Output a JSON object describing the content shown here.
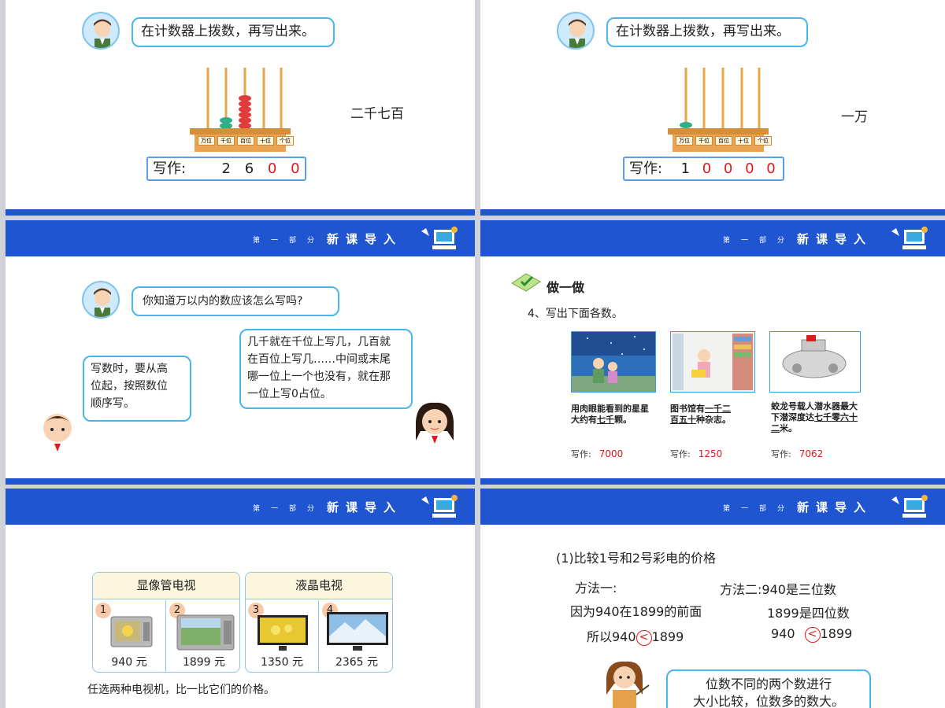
{
  "slide1": {
    "bubble": "在计数器上拨数，再写出来。",
    "word": "二千七百",
    "write_label": "写作:",
    "digits": [
      "2",
      "6",
      "0",
      "0"
    ],
    "places": [
      "万位",
      "千位",
      "百位",
      "十位",
      "个位"
    ]
  },
  "slide2": {
    "bubble": "在计数器上拨数，再写出来。",
    "word": "一万",
    "write_label": "写作:",
    "digits": [
      "1",
      "0",
      "0",
      "0",
      "0"
    ],
    "places": [
      "万位",
      "千位",
      "百位",
      "十位",
      "个位"
    ]
  },
  "header": {
    "part": "第一部分",
    "title": "新课导入"
  },
  "slide3": {
    "question": "你知道万以内的数应该怎么写吗?",
    "boy_text": [
      "写数时，要从高",
      "位起，按照数位",
      "顺序写。"
    ],
    "girl_text": [
      "几千就在千位上写几，几百就",
      "在百位上写几……中间或末尾",
      "哪一位上一个也没有，就在那",
      "一位上写0占位。"
    ]
  },
  "slide4": {
    "section": "做一做",
    "instruction": "4、写出下面各数。",
    "items": [
      {
        "pre": "用肉眼能看到的星星大约有",
        "u": "七千",
        "post": "颗。",
        "write_label": "写作:",
        "value": "7000"
      },
      {
        "pre": "图书馆有",
        "u": "一千二百五十",
        "post": "种杂志。",
        "write_label": "写作:",
        "value": "1250"
      },
      {
        "pre": "蛟龙号载人潜水器最大下潜深度达",
        "u": "七千零六十二",
        "post": "米。",
        "write_label": "写作:",
        "value": "7062"
      }
    ]
  },
  "slide5": {
    "groups": [
      "显像管电视",
      "液晶电视"
    ],
    "tvs": [
      {
        "num": "1",
        "price": "940 元"
      },
      {
        "num": "2",
        "price": "1899 元"
      },
      {
        "num": "3",
        "price": "1350 元"
      },
      {
        "num": "4",
        "price": "2365 元"
      }
    ],
    "prompt": "任选两种电视机，比一比它们的价格。"
  },
  "slide6": {
    "title": "(1)比较1号和2号彩电的价格",
    "m1_label": "方法一:",
    "m1_line1": "因为940在1899的前面",
    "m1_line2a": "所以940",
    "m1_sign": "<",
    "m1_line2b": "1899",
    "m2_line1": "方法二:940是三位数",
    "m2_line2": "1899是四位数",
    "m2_line3a": "940",
    "m2_sign": "<",
    "m2_line3b": "1899",
    "teacher_text": [
      "位数不同的两个数进行",
      "大小比较，位数多的数大。"
    ]
  },
  "colors": {
    "band": "#1f55d0",
    "bubble_border": "#49b7ec",
    "red": "#e0191e"
  }
}
